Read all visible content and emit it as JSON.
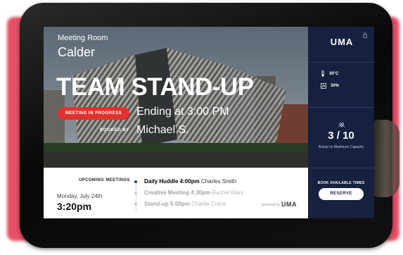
{
  "hero": {
    "room_label": "Meeting Room",
    "room_name": "Calder",
    "meeting_title": "TEAM STAND-UP",
    "status": "MEETING IN PROGRESS",
    "ending": "Ending at 3:00 PM",
    "booked_by_label": "BOOKED BY",
    "booked_by_name": "Michael S."
  },
  "panel": {
    "logo_text": "UMA",
    "temperature": "30°C",
    "humidity": "30%",
    "capacity": "3 / 10",
    "capacity_label": "Actual vs Maximum Capacity",
    "book_label": "BOOK AVAILABLE TIMES",
    "reserve_label": "RESERVE"
  },
  "schedule": {
    "upcoming_label": "UPCOMING MEETINGS",
    "date": "Monday,  July 24th",
    "time": "3:20pm",
    "meetings": [
      {
        "title": "Daily Huddle 4:00pm",
        "person": "Charles Smith"
      },
      {
        "title": "Creative Meeting 4:30pm",
        "person": "Rachel Mary"
      },
      {
        "title": "Stand-up 5:00pm",
        "person": "Charlie Crane"
      }
    ]
  },
  "footer": {
    "powered_by": "powered by",
    "logo_text": "UMA"
  },
  "colors": {
    "panel_bg": "#16203f",
    "status_red": "#e1322e",
    "active_dot": "#1d3d8f"
  }
}
